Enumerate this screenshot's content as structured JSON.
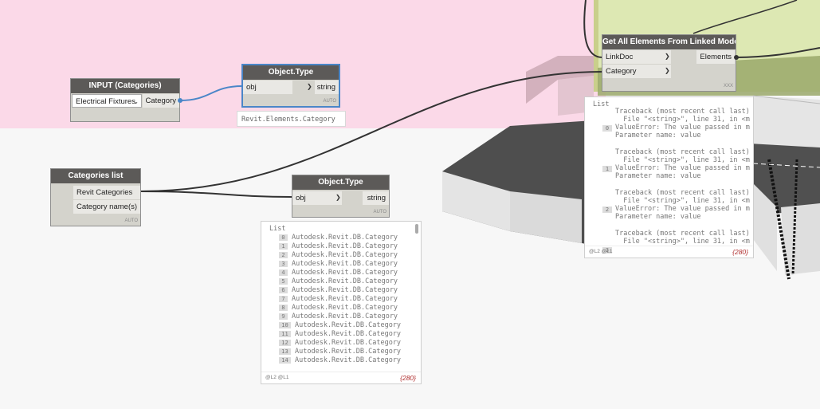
{
  "nodes": {
    "input_categories": {
      "title": "INPUT (Categories)",
      "dropdown_value": "Electrical Fixtures",
      "output": "Category"
    },
    "object_type_1": {
      "title": "Object.Type",
      "input": "obj",
      "output": "string",
      "lacing": "AUTO",
      "tooltip": "Revit.Elements.Category"
    },
    "categories_list": {
      "title": "Categories list",
      "outputs": [
        "Revit Categories",
        "Category name(s)"
      ],
      "lacing": "AUTO"
    },
    "object_type_2": {
      "title": "Object.Type",
      "input": "obj",
      "output": "string",
      "lacing": "AUTO"
    },
    "get_all_elements": {
      "title": "Get All Elements From Linked Model",
      "inputs": [
        "LinkDoc",
        "Category"
      ],
      "output": "Elements",
      "lacing": "XXX"
    }
  },
  "preview_categories": {
    "header": "List",
    "items": [
      {
        "index": "0",
        "value": "Autodesk.Revit.DB.Category"
      },
      {
        "index": "1",
        "value": "Autodesk.Revit.DB.Category"
      },
      {
        "index": "2",
        "value": "Autodesk.Revit.DB.Category"
      },
      {
        "index": "3",
        "value": "Autodesk.Revit.DB.Category"
      },
      {
        "index": "4",
        "value": "Autodesk.Revit.DB.Category"
      },
      {
        "index": "5",
        "value": "Autodesk.Revit.DB.Category"
      },
      {
        "index": "6",
        "value": "Autodesk.Revit.DB.Category"
      },
      {
        "index": "7",
        "value": "Autodesk.Revit.DB.Category"
      },
      {
        "index": "8",
        "value": "Autodesk.Revit.DB.Category"
      },
      {
        "index": "9",
        "value": "Autodesk.Revit.DB.Category"
      },
      {
        "index": "10",
        "value": "Autodesk.Revit.DB.Category"
      },
      {
        "index": "11",
        "value": "Autodesk.Revit.DB.Category"
      },
      {
        "index": "12",
        "value": "Autodesk.Revit.DB.Category"
      },
      {
        "index": "13",
        "value": "Autodesk.Revit.DB.Category"
      },
      {
        "index": "14",
        "value": "Autodesk.Revit.DB.Category"
      }
    ],
    "levels": "@L2 @L1",
    "count": "{280}"
  },
  "preview_errors": {
    "header": "List",
    "items": [
      {
        "index": "0",
        "line1": "Traceback (most recent call last)",
        "line2": "  File \"<string>\", line 31, in <m",
        "line3": "ValueError: The value passed in m",
        "line4": "Parameter name: value"
      },
      {
        "index": "1",
        "line1": "Traceback (most recent call last)",
        "line2": "  File \"<string>\", line 31, in <m",
        "line3": "ValueError: The value passed in m",
        "line4": "Parameter name: value"
      },
      {
        "index": "2",
        "line1": "Traceback (most recent call last)",
        "line2": "  File \"<string>\", line 31, in <m",
        "line3": "ValueError: The value passed in m",
        "line4": "Parameter name: value"
      },
      {
        "index": "3",
        "line1": "Traceback (most recent call last)",
        "line2": "  File \"<string>\", line 31, in <m",
        "line3": "",
        "line4": ""
      }
    ],
    "levels": "@L2 @L1",
    "count": "{280}"
  },
  "colors": {
    "group_pink": "#fbd9e8",
    "group_green": "#dde8b3",
    "node_header": "#5c5a58",
    "node_body": "#d4d3cc",
    "selected_wire": "#4a86c8",
    "count_red": "#b03030"
  }
}
